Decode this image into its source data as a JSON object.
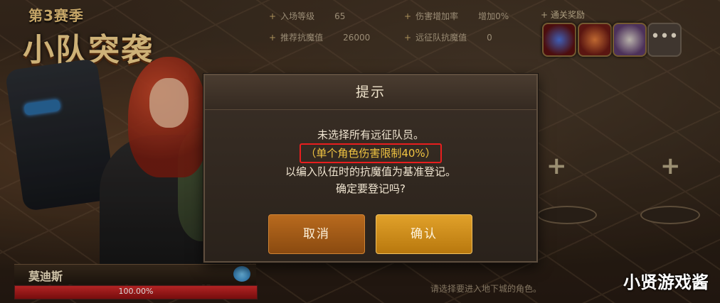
{
  "event": {
    "season_tag": "第3赛季",
    "title": "小队突袭"
  },
  "info": {
    "entry_level_label": "入场等级",
    "entry_level_value": "65",
    "damage_bonus_label": "伤害增加率",
    "damage_bonus_value": "增加0%",
    "recommended_label": "推荐抗魔值",
    "recommended_value": "26000",
    "expedition_label": "远征队抗魔值",
    "expedition_value": "0"
  },
  "rewards": {
    "label": "通关奖励",
    "more": "•••"
  },
  "character": {
    "name": "莫迪斯",
    "hp_text": "100.00%",
    "hp_fraction": 1.0
  },
  "hint": "请选择要进入地下城的角色。",
  "dialog": {
    "title": "提示",
    "line1": "未选择所有远征队员。",
    "line2": "（单个角色伤害限制40%）",
    "line3": "以编入队伍时的抗魔值为基准登记。",
    "line4": "确定要登记吗?",
    "cancel": "取消",
    "confirm": "确认"
  },
  "slots": {
    "plus": "+"
  },
  "watermark": "小贤游戏酱",
  "colors": {
    "warning_border": "#e81e1e",
    "warning_text": "#f2c542",
    "confirm": "#d9981f",
    "cancel": "#a65d18"
  }
}
